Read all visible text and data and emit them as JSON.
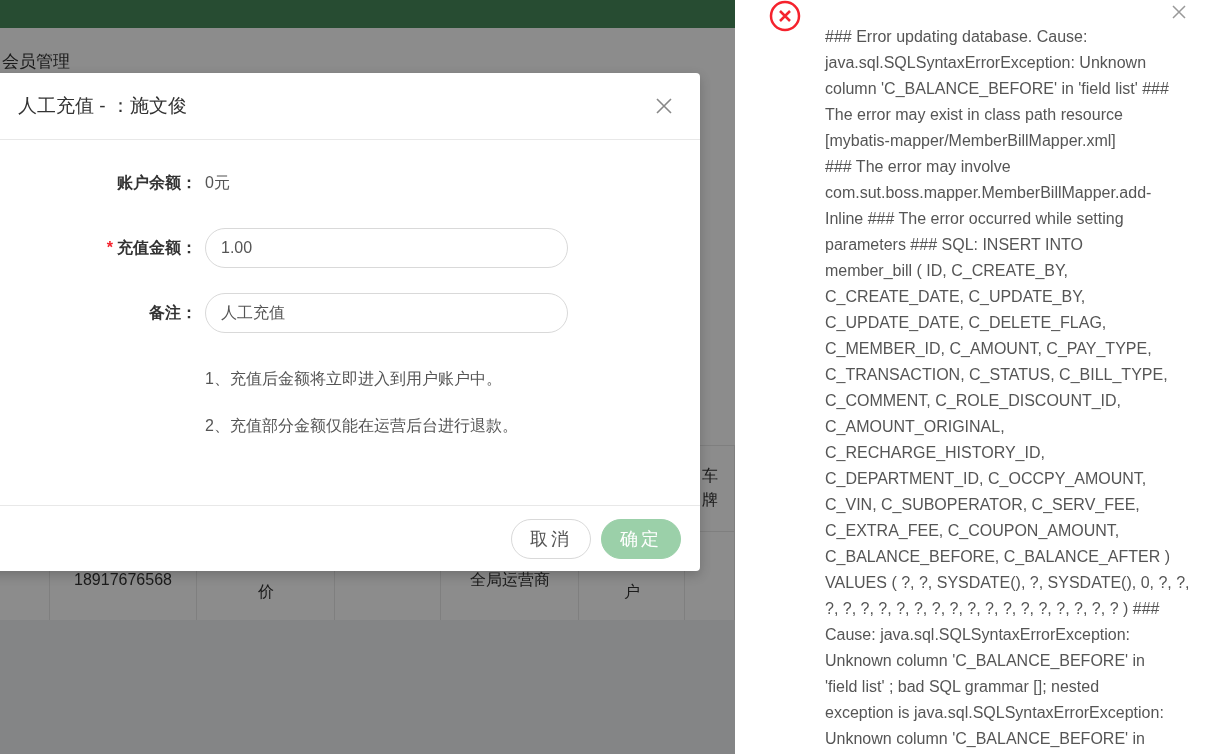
{
  "page": {
    "title": "会员管理",
    "table": {
      "header_cells": [
        "车牌"
      ],
      "row": [
        "18917676568",
        "价",
        "全局运营商",
        "户"
      ]
    }
  },
  "dialog": {
    "title": "人工充值 - ：施文俊",
    "required_mark": "*",
    "fields": [
      {
        "kind": "static",
        "label": "账户余额：",
        "value": "0元",
        "required": false
      },
      {
        "kind": "input",
        "label": "充值金额：",
        "value": "1.00",
        "required": true
      },
      {
        "kind": "input",
        "label": "备注：",
        "value": "人工充值",
        "required": false
      }
    ],
    "notes": [
      "1、充值后金额将立即进入到用户账户中。",
      "2、充值部分金额仅能在运营后台进行退款。"
    ],
    "buttons": [
      {
        "kind": "default",
        "label": "取消",
        "disabled": false
      },
      {
        "kind": "primary",
        "label": "确定",
        "disabled": true
      }
    ]
  },
  "error_notification": {
    "lines": [
      "### Error updating database. Cause:",
      "java.sql.SQLSyntaxErrorException: Unknown",
      "column 'C_BALANCE_BEFORE' in 'field list' ###",
      "The error may exist in class path resource",
      "[mybatis-mapper/MemberBillMapper.xml]",
      "### The error may involve",
      "com.sut.boss.mapper.MemberBillMapper.add-",
      "Inline ### The error occurred while setting",
      "parameters ### SQL: INSERT INTO",
      "member_bill ( ID, C_CREATE_BY,",
      "C_CREATE_DATE, C_UPDATE_BY,",
      "C_UPDATE_DATE, C_DELETE_FLAG,",
      "C_MEMBER_ID, C_AMOUNT, C_PAY_TYPE,",
      "C_TRANSACTION, C_STATUS, C_BILL_TYPE,",
      "C_COMMENT, C_ROLE_DISCOUNT_ID,",
      "C_AMOUNT_ORIGINAL,",
      "C_RECHARGE_HISTORY_ID,",
      "C_DEPARTMENT_ID, C_OCCPY_AMOUNT,",
      "C_VIN, C_SUBOPERATOR, C_SERV_FEE,",
      "C_EXTRA_FEE, C_COUPON_AMOUNT,",
      "C_BALANCE_BEFORE, C_BALANCE_AFTER )",
      "VALUES ( ?, ?, SYSDATE(), ?, SYSDATE(), 0, ?, ?,",
      "?, ?, ?, ?, ?, ?, ?, ?, ?, ?, ?, ?, ?, ?, ?, ?, ? ) ###",
      "Cause: java.sql.SQLSyntaxErrorException:",
      "Unknown column 'C_BALANCE_BEFORE' in",
      "'field list' ; bad SQL grammar []; nested",
      "exception is java.sql.SQLSyntaxErrorException:",
      "Unknown column 'C_BALANCE_BEFORE' in"
    ]
  }
}
